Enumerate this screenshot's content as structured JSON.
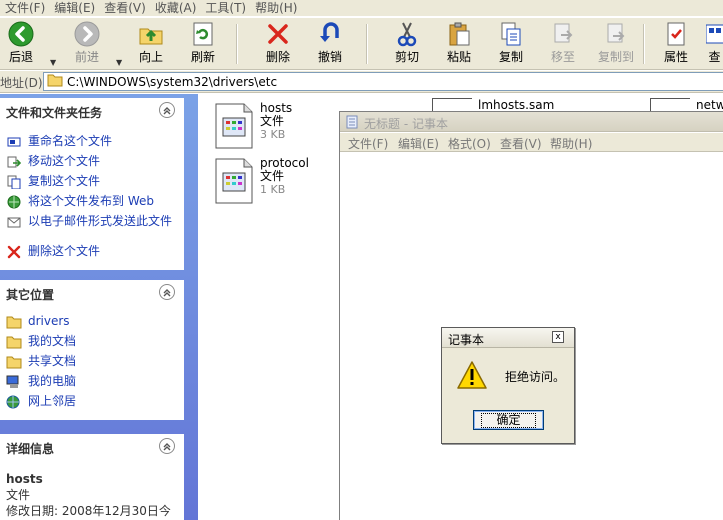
{
  "explorer": {
    "menu": [
      "文件(F)",
      "编辑(E)",
      "查看(V)",
      "收藏(A)",
      "工具(T)",
      "帮助(H)"
    ],
    "toolbar": {
      "back": "后退",
      "forward": "前进",
      "up": "向上",
      "refresh": "刷新",
      "delete": "删除",
      "undo": "撤销",
      "cut": "剪切",
      "paste": "粘贴",
      "copy": "复制",
      "move_to": "移至",
      "copy_to": "复制到",
      "properties": "属性",
      "views": "查"
    },
    "address": {
      "label": "地址(D)",
      "path": "C:\\WINDOWS\\system32\\drivers\\etc"
    }
  },
  "tasks": {
    "file_tasks": {
      "title": "文件和文件夹任务",
      "items": [
        {
          "label": "重命名这个文件",
          "icon": "rename-icon"
        },
        {
          "label": "移动这个文件",
          "icon": "move-icon"
        },
        {
          "label": "复制这个文件",
          "icon": "copy-file-icon"
        },
        {
          "label": "将这个文件发布到 Web",
          "icon": "web-publish-icon"
        },
        {
          "label": "以电子邮件形式发送此文件",
          "icon": "email-icon"
        },
        {
          "label": "删除这个文件",
          "icon": "delete-icon"
        }
      ]
    },
    "other_places": {
      "title": "其它位置",
      "items": [
        {
          "label": "drivers",
          "icon": "folder-icon"
        },
        {
          "label": "我的文档",
          "icon": "folder-icon"
        },
        {
          "label": "共享文档",
          "icon": "folder-icon"
        },
        {
          "label": "我的电脑",
          "icon": "computer-icon"
        },
        {
          "label": "网上邻居",
          "icon": "network-icon"
        }
      ]
    },
    "details": {
      "title": "详细信息",
      "name": "hosts",
      "type": "文件",
      "modified": "修改日期: 2008年12月30日今"
    }
  },
  "files": [
    {
      "name": "hosts",
      "type": "文件",
      "size": "3 KB"
    },
    {
      "name": "protocol",
      "type": "文件",
      "size": "1 KB"
    }
  ],
  "files_partial": [
    "lmhosts.sam",
    "netw"
  ],
  "notepad": {
    "title": "无标题 - 记事本",
    "menu": [
      "文件(F)",
      "编辑(E)",
      "格式(O)",
      "查看(V)",
      "帮助(H)"
    ]
  },
  "dialog": {
    "title": "记事本",
    "message": "拒绝访问。",
    "ok": "确定",
    "close": "x"
  },
  "colors": {
    "task_pane_gradient_top": "#7ba2e7",
    "task_pane_gradient_bottom": "#6375d6",
    "task_link": "#1c3db4",
    "chrome": "#ece9d8"
  }
}
